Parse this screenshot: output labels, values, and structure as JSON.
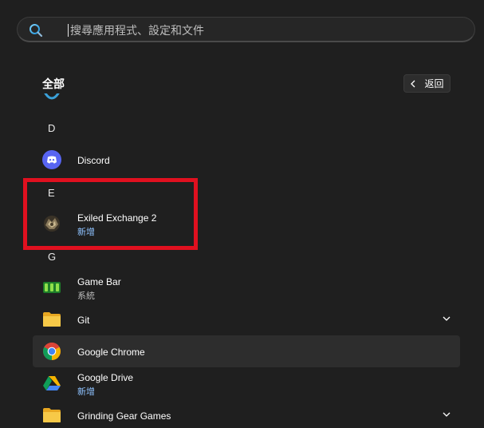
{
  "search": {
    "placeholder": "搜尋應用程式、設定和文件"
  },
  "header": {
    "section_title": "全部",
    "back_label": "返回"
  },
  "letters": {
    "d": "D",
    "e": "E",
    "g": "G"
  },
  "apps": [
    {
      "name": "Discord",
      "subtitle": "",
      "icon": "discord-icon"
    },
    {
      "name": "Exiled Exchange 2",
      "subtitle": "新增",
      "icon": "exiled-exchange-icon"
    },
    {
      "name": "Game Bar",
      "subtitle": "系統",
      "icon": "game-bar-icon"
    },
    {
      "name": "Git",
      "subtitle": "",
      "icon": "folder-icon",
      "expandable": true
    },
    {
      "name": "Google Chrome",
      "subtitle": "",
      "icon": "chrome-icon"
    },
    {
      "name": "Google Drive",
      "subtitle": "新增",
      "icon": "google-drive-icon"
    },
    {
      "name": "Grinding Gear Games",
      "subtitle": "",
      "icon": "folder-icon",
      "expandable": true
    }
  ],
  "colors": {
    "background": "#1f1f1f",
    "accent_new": "#8ec2ff",
    "highlight": "#e0101f"
  }
}
